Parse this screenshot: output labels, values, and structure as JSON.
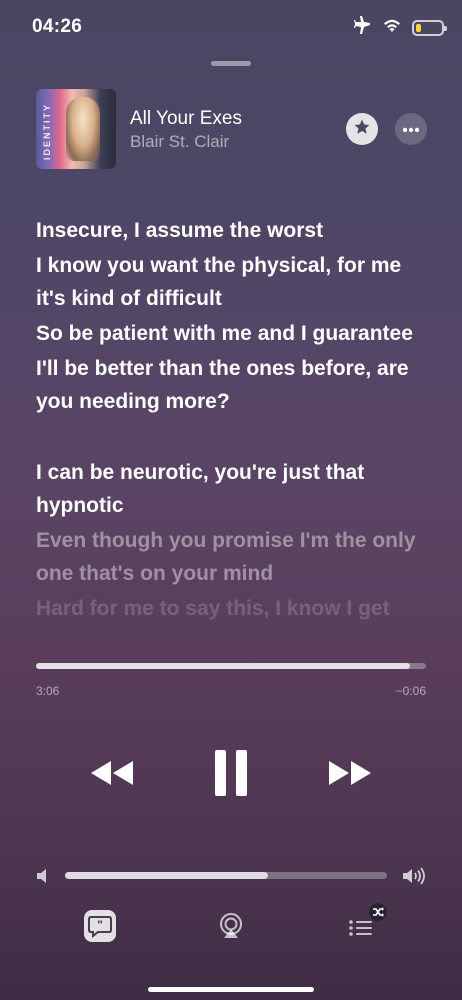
{
  "status_bar": {
    "time": "04:26",
    "airplane_icon": "airplane-icon",
    "wifi_icon": "wifi-icon",
    "battery_color": "#f4d53a",
    "battery_level": 0.2
  },
  "now_playing": {
    "artwork_text": "IDENTITY",
    "title": "All Your Exes",
    "artist": "Blair St. Clair",
    "favorite_icon": "star-icon",
    "more_icon": "ellipsis-icon"
  },
  "lyrics": [
    {
      "text": "Insecure, I assume the worst",
      "state": "active"
    },
    {
      "text": "I know you want the physical, for me it's kind of difficult",
      "state": "active"
    },
    {
      "text": "So be patient with me and I guarantee",
      "state": "active"
    },
    {
      "text": "I'll be better than the ones before, are you needing more?",
      "state": "active"
    },
    {
      "text": "I can be neurotic, you're just that hypnotic",
      "state": "active"
    },
    {
      "text": "Even though you promise I'm the only one that's on your mind",
      "state": "upcoming"
    },
    {
      "text": "Hard for me to say this, I know I get",
      "state": "faded"
    }
  ],
  "playback": {
    "elapsed": "3:06",
    "remaining": "−0:06",
    "progress": 0.96
  },
  "controls": {
    "previous_icon": "rewind-icon",
    "pause_icon": "pause-icon",
    "next_icon": "fast-forward-icon"
  },
  "volume": {
    "level": 0.63,
    "low_icon": "speaker-low-icon",
    "high_icon": "speaker-high-icon"
  },
  "bottom_bar": {
    "lyrics_icon": "lyrics-icon",
    "airplay_icon": "airplay-icon",
    "queue_icon": "queue-icon",
    "shuffle_icon": "shuffle-icon"
  }
}
